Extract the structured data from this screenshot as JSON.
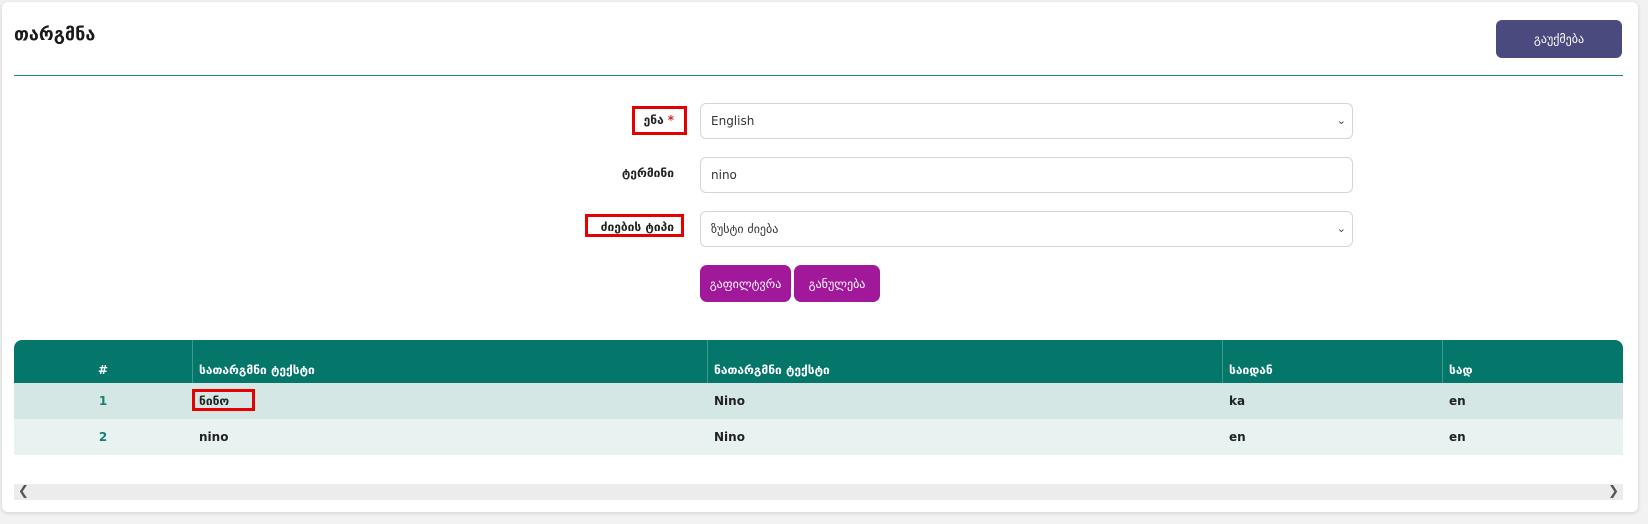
{
  "header": {
    "title": "თარგმნა",
    "cancel_label": "გაუქმება"
  },
  "form": {
    "language_label": "ენა",
    "language_required": "*",
    "language_value": "English",
    "term_label": "ტერმინი",
    "term_value": "nino",
    "search_type_label": "ძიების ტიპი",
    "search_type_value": "ზუსტი ძიება",
    "filter_label": "გაფილტვრა",
    "reset_label": "განულება"
  },
  "table": {
    "columns": [
      "#",
      "სათარგმნი ტექსტი",
      "ნათარგმნი ტექსტი",
      "საიდან",
      "სად"
    ],
    "rows": [
      [
        "1",
        "ნინო",
        "Nino",
        "ka",
        "en"
      ],
      [
        "2",
        "nino",
        "Nino",
        "en",
        "en"
      ]
    ]
  },
  "scrollbar": {
    "left_icon": "chevron-left-icon",
    "right_icon": "chevron-right-icon"
  },
  "colors": {
    "accent_teal": "#04766a",
    "purple_button": "#a1189a",
    "cancel_button": "#4b4a7e",
    "highlight": "#e60000"
  }
}
